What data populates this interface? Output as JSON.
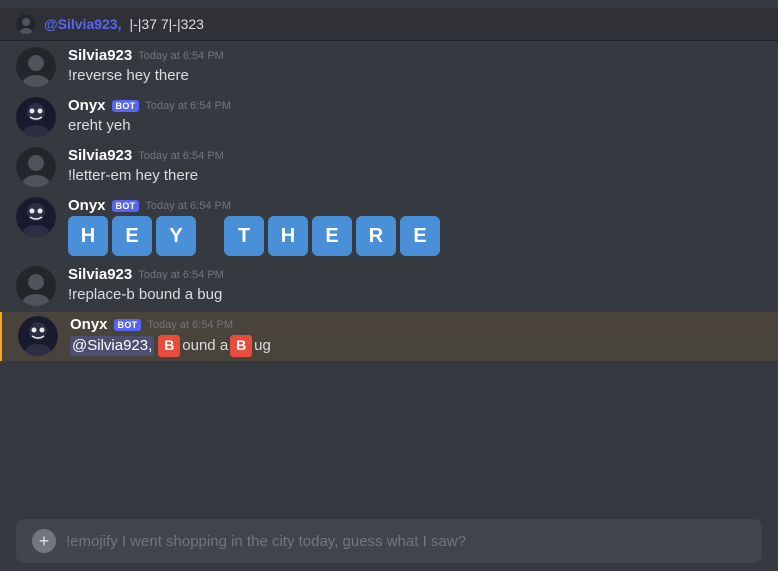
{
  "top_message": {
    "mention": "@Silvia923,",
    "text": "|-|37 7|-|323"
  },
  "messages": [
    {
      "id": "msg1",
      "type": "user",
      "username": "Silvia923",
      "timestamp": "Today at 6:54 PM",
      "text": "!reverse hey there",
      "is_bot": false
    },
    {
      "id": "msg2",
      "type": "bot",
      "username": "Onyx",
      "timestamp": "Today at 6:54 PM",
      "text": "ereht yeh",
      "is_bot": true
    },
    {
      "id": "msg3",
      "type": "user",
      "username": "Silvia923",
      "timestamp": "Today at 6:54 PM",
      "text": "!letter-em hey there",
      "is_bot": false
    },
    {
      "id": "msg4",
      "type": "bot",
      "username": "Onyx",
      "timestamp": "Today at 6:54 PM",
      "letters": [
        "H",
        "E",
        "Y",
        "",
        "T",
        "H",
        "E",
        "R",
        "E"
      ],
      "is_bot": true
    },
    {
      "id": "msg5",
      "type": "user",
      "username": "Silvia923",
      "timestamp": "Today at 6:54 PM",
      "text": "!replace-b bound a bug",
      "is_bot": false
    },
    {
      "id": "msg6",
      "type": "bot",
      "username": "Onyx",
      "timestamp": "Today at 6:54 PM",
      "replace_b": true,
      "mention": "@Silvia923,",
      "pre": "",
      "word1": "ound a ",
      "word2": "ug",
      "is_bot": true,
      "highlighted": true
    }
  ],
  "input": {
    "placeholder": "!emojify I went shopping in the city today, guess what I saw?",
    "value": "!emojify I went shopping in the city today, guess what I saw?"
  },
  "bot_badge": "BOT"
}
